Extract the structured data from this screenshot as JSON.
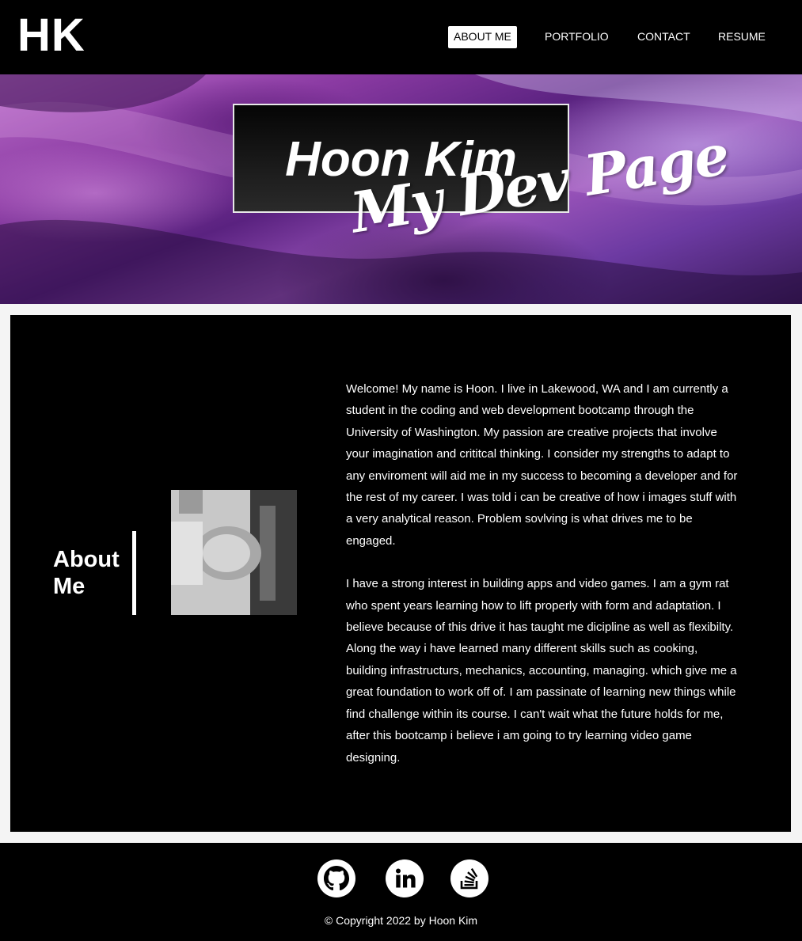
{
  "header": {
    "logo": "HK",
    "nav": [
      {
        "label": "ABOUT ME",
        "active": true
      },
      {
        "label": "PORTFOLIO",
        "active": false
      },
      {
        "label": "CONTACT",
        "active": false
      },
      {
        "label": "RESUME",
        "active": false
      }
    ]
  },
  "hero": {
    "title": "Hoon Kim",
    "subtitle": "My Dev Page"
  },
  "about": {
    "heading_line1": "About",
    "heading_line2": "Me",
    "paragraphs": [
      "Welcome! My name is Hoon. I live in Lakewood, WA and I am currently a student in the coding and web development bootcamp through the University of Washington. My passion are creative projects that involve your imagination and crititcal thinking. I consider my strengths to adapt to any enviroment will aid me in my success to becoming a developer and for the rest of my career. I was told i can be creative of how i images stuff with a very analytical reason. Problem sovlving is what drives me to be engaged.",
      "I have a strong interest in building apps and video games. I am a gym rat who spent years learning how to lift properly with form and adaptation. I believe because of this drive it has taught me dicipline as well as flexibilty. Along the way i have learned many different skills such as cooking, building infrastructurs, mechanics, accounting, managing. which give me a great foundation to work off of. I am passinate of learning new things while find challenge within its course. I can't wait what the future holds for me, after this bootcamp i believe i am going to try learning video game designing."
    ]
  },
  "footer": {
    "social_icons": [
      "github-icon",
      "linkedin-icon",
      "stackoverflow-icon"
    ],
    "copyright": "© Copyright 2022 by Hoon Kim"
  },
  "colors": {
    "header_bg": "#000000",
    "page_bg": "#f4f4f4",
    "accent": "#9752b8"
  }
}
